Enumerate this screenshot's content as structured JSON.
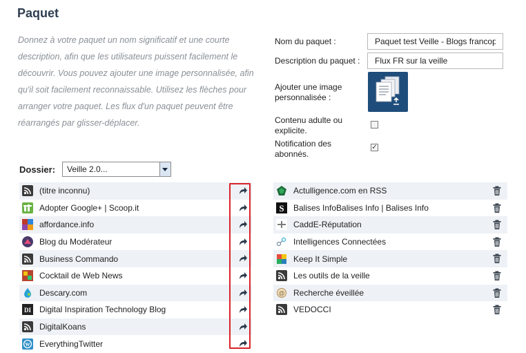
{
  "page": {
    "title": "Paquet",
    "description": "Donnez à votre paquet un nom significatif et une courte description, afin que les utilisateurs puissent facilement le découvrir. Vous pouvez ajouter une image personnalisée, afin qu'il soit facilement reconnaissable. Utilisez les flèches pour arranger votre paquet. Les flux d'un paquet peuvent être réarrangés par glisser-déplacer."
  },
  "form": {
    "name_label": "Nom du paquet :",
    "name_value": "Paquet test Veille - Blogs francoph",
    "desc_label": "Description du paquet :",
    "desc_value": "Flux FR sur la veille",
    "image_label": "Ajouter une image personnalisée :",
    "adult_label": "Contenu adulte ou explicite.",
    "adult_checked": false,
    "notify_label": "Notification des abonnés.",
    "notify_checked": true
  },
  "folder": {
    "label": "Dossier:",
    "selected": "Veille 2.0..."
  },
  "available_feeds": [
    {
      "name": "(titre inconnu)",
      "icon": "rss-icon"
    },
    {
      "name": "Adopter Google+ | Scoop.it",
      "icon": "scoopit-icon"
    },
    {
      "name": "affordance.info",
      "icon": "affordance-icon"
    },
    {
      "name": "Blog du Modérateur",
      "icon": "blogdumoderateur-icon"
    },
    {
      "name": "Business Commando",
      "icon": "rss-icon"
    },
    {
      "name": "Cocktail de Web News",
      "icon": "cocktail-icon"
    },
    {
      "name": "Descary.com",
      "icon": "descary-icon"
    },
    {
      "name": "Digital Inspiration Technology Blog",
      "icon": "digital-inspiration-icon"
    },
    {
      "name": "DigitalKoans",
      "icon": "rss-icon"
    },
    {
      "name": "EverythingTwitter",
      "icon": "wordpress-icon"
    }
  ],
  "package_feeds": [
    {
      "name": "Actulligence.com en RSS",
      "icon": "actulligence-icon"
    },
    {
      "name": "Balises InfoBalises Info | Balises Info",
      "icon": "balises-icon"
    },
    {
      "name": "CaddE-Réputation",
      "icon": "cadde-icon"
    },
    {
      "name": "Intelligences Connectées",
      "icon": "intelligences-icon"
    },
    {
      "name": "Keep It Simple",
      "icon": "keepitsimple-icon"
    },
    {
      "name": "Les outils de la veille",
      "icon": "rss-icon"
    },
    {
      "name": "Recherche éveillée",
      "icon": "recherche-icon"
    },
    {
      "name": "VEDOCCI",
      "icon": "rss-icon"
    }
  ],
  "colors": {
    "title": "#2f3e50",
    "description": "#8a8f96",
    "row_alt": "#eef1f5",
    "highlight_box": "#d8232a",
    "image_tile": "#1f4d7b"
  }
}
